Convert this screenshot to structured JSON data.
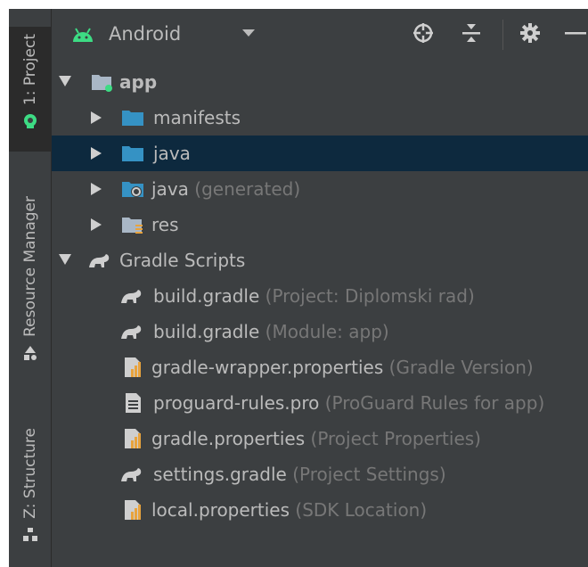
{
  "toolwindow_strip": {
    "project_tab": "1: Project",
    "resource_tab": "Resource Manager",
    "structure_tab": "Z: Structure"
  },
  "header": {
    "view_selector": "Android",
    "icons": [
      "locate-icon",
      "collapse-all-icon",
      "gear-icon",
      "minimize-icon"
    ]
  },
  "tree": {
    "app": "app",
    "manifests": "manifests",
    "java": "java",
    "java_generated": "java",
    "java_generated_hint": "(generated)",
    "res": "res",
    "gradle_scripts": "Gradle Scripts",
    "files": [
      {
        "name": "build.gradle",
        "hint": "(Project: Diplomski rad)",
        "icon": "gradle-icon"
      },
      {
        "name": "build.gradle",
        "hint": "(Module: app)",
        "icon": "gradle-icon"
      },
      {
        "name": "gradle-wrapper.properties",
        "hint": "(Gradle Version)",
        "icon": "properties-icon"
      },
      {
        "name": "proguard-rules.pro",
        "hint": "(ProGuard Rules for app)",
        "icon": "text-file-icon"
      },
      {
        "name": "gradle.properties",
        "hint": "(Project Properties)",
        "icon": "properties-icon"
      },
      {
        "name": "settings.gradle",
        "hint": "(Project Settings)",
        "icon": "gradle-icon"
      },
      {
        "name": "local.properties",
        "hint": "(SDK Location)",
        "icon": "properties-icon"
      }
    ]
  },
  "colors": {
    "background": "#3c3f41",
    "selection": "#0d293e",
    "text": "#bbbbbb",
    "hint_text": "#777777",
    "folder_blue": "#3592c4",
    "android_green": "#3ddc84"
  }
}
